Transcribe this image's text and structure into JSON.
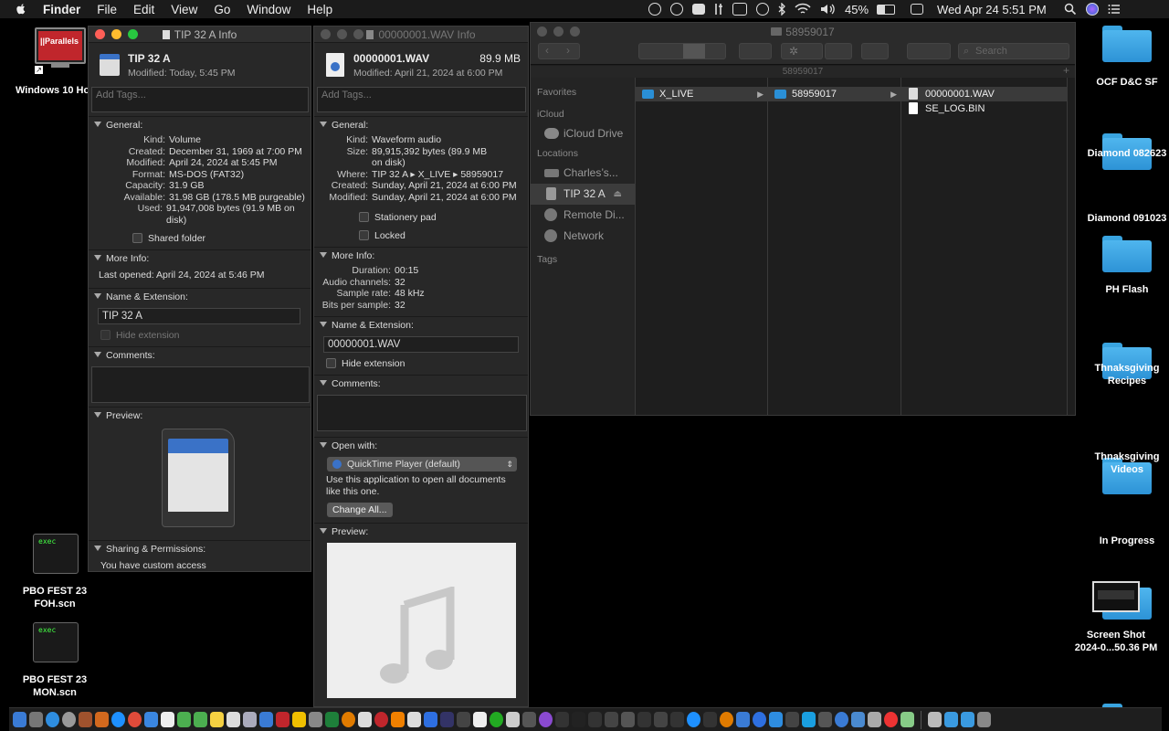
{
  "menubar": {
    "app": "Finder",
    "items": [
      "File",
      "Edit",
      "View",
      "Go",
      "Window",
      "Help"
    ],
    "battery": "45%",
    "clock": "Wed Apr 24  5:51 PM"
  },
  "desktop_left": [
    {
      "label": "Windows 10 Ho",
      "icon": "parallels-vm-icon",
      "badge": "||Parallels"
    },
    {
      "label": "PBO FEST 23\nFOH.scn",
      "icon": "exec-file-icon",
      "exec": "exec"
    },
    {
      "label": "PBO FEST 23\nMON.scn",
      "icon": "exec-file-icon",
      "exec": "exec"
    }
  ],
  "desktop_right": [
    {
      "label": "OCF D&C SF"
    },
    {
      "label": "Diamond 082623"
    },
    {
      "label": "Diamond 091023"
    },
    {
      "label": "PH Flash"
    },
    {
      "label": "Thnaksgiving Recipes"
    },
    {
      "label": "Thnaksgiving Videos"
    },
    {
      "label": "In Progress"
    }
  ],
  "screenshot_file": {
    "label1": "Screen Shot",
    "label2": "2024-0...50.36 PM"
  },
  "info1": {
    "window_title": "TIP 32 A Info",
    "name": "TIP 32 A",
    "modified": "Modified: Today, 5:45 PM",
    "tags_placeholder": "Add Tags...",
    "general_label": "General:",
    "general": [
      {
        "k": "Kind:",
        "v": "Volume"
      },
      {
        "k": "Created:",
        "v": "December 31, 1969 at 7:00 PM"
      },
      {
        "k": "Modified:",
        "v": "April 24, 2024 at 5:45 PM"
      },
      {
        "k": "Format:",
        "v": "MS-DOS (FAT32)"
      },
      {
        "k": "Capacity:",
        "v": "31.9 GB"
      },
      {
        "k": "Available:",
        "v": "31.98 GB (178.5 MB purgeable)"
      },
      {
        "k": "Used:",
        "v": "91,947,008 bytes (91.9 MB on disk)"
      }
    ],
    "shared_folder": "Shared folder",
    "more_info_label": "More Info:",
    "last_opened": "Last opened: April 24, 2024 at 5:46 PM",
    "name_ext_label": "Name & Extension:",
    "name_field": "TIP 32 A",
    "hide_ext": "Hide extension",
    "comments_label": "Comments:",
    "preview_label": "Preview:",
    "sharing_label": "Sharing & Permissions:",
    "sharing_text": "You have custom access"
  },
  "info2": {
    "window_title": "00000001.WAV Info",
    "name": "00000001.WAV",
    "size_big": "89.9 MB",
    "modified": "Modified: April 21, 2024 at 6:00 PM",
    "tags_placeholder": "Add Tags...",
    "general_label": "General:",
    "general": [
      {
        "k": "Kind:",
        "v": "Waveform audio"
      },
      {
        "k": "Size:",
        "v": "89,915,392 bytes (89.9 MB"
      },
      {
        "k": "",
        "v": "on disk)"
      },
      {
        "k": "Where:",
        "v": "TIP 32 A ▸ X_LIVE ▸ 58959017"
      },
      {
        "k": "Created:",
        "v": "Sunday, April 21, 2024 at 6:00 PM"
      },
      {
        "k": "Modified:",
        "v": "Sunday, April 21, 2024 at 6:00 PM"
      }
    ],
    "stationery": "Stationery pad",
    "locked": "Locked",
    "more_info_label": "More Info:",
    "more_info": [
      {
        "k": "Duration:",
        "v": "00:15"
      },
      {
        "k": "Audio channels:",
        "v": "32"
      },
      {
        "k": "Sample rate:",
        "v": "48 kHz"
      },
      {
        "k": "Bits per sample:",
        "v": "32"
      }
    ],
    "name_ext_label": "Name & Extension:",
    "name_field": "00000001.WAV",
    "hide_ext": "Hide extension",
    "comments_label": "Comments:",
    "open_with_label": "Open with:",
    "open_with_app": "QuickTime Player (default)",
    "open_with_desc": "Use this application to open all documents like this one.",
    "change_all": "Change All...",
    "preview_label": "Preview:"
  },
  "finder": {
    "title": "58959017",
    "path_title": "58959017",
    "search_placeholder": "Search",
    "sidebar": [
      {
        "type": "header",
        "label": "Favorites"
      },
      {
        "type": "header",
        "label": "iCloud"
      },
      {
        "type": "item",
        "label": "iCloud Drive",
        "icon": "cloud-icon"
      },
      {
        "type": "header",
        "label": "Locations"
      },
      {
        "type": "item",
        "label": "Charles’s...",
        "icon": "laptop-icon"
      },
      {
        "type": "item",
        "label": "TIP 32 A",
        "icon": "drive-icon",
        "selected": true,
        "eject": "⏏"
      },
      {
        "type": "item",
        "label": "Remote Di...",
        "icon": "disc-icon"
      },
      {
        "type": "item",
        "label": "Network",
        "icon": "network-icon"
      },
      {
        "type": "header",
        "label": "Tags"
      }
    ],
    "col1": [
      {
        "label": "X_LIVE",
        "type": "folder",
        "selected": true
      }
    ],
    "col2": [
      {
        "label": "58959017",
        "type": "folder",
        "selected": true
      }
    ],
    "col3": [
      {
        "label": "00000001.WAV",
        "type": "doc",
        "selected": true
      },
      {
        "label": "SE_LOG.BIN",
        "type": "doc"
      }
    ]
  }
}
